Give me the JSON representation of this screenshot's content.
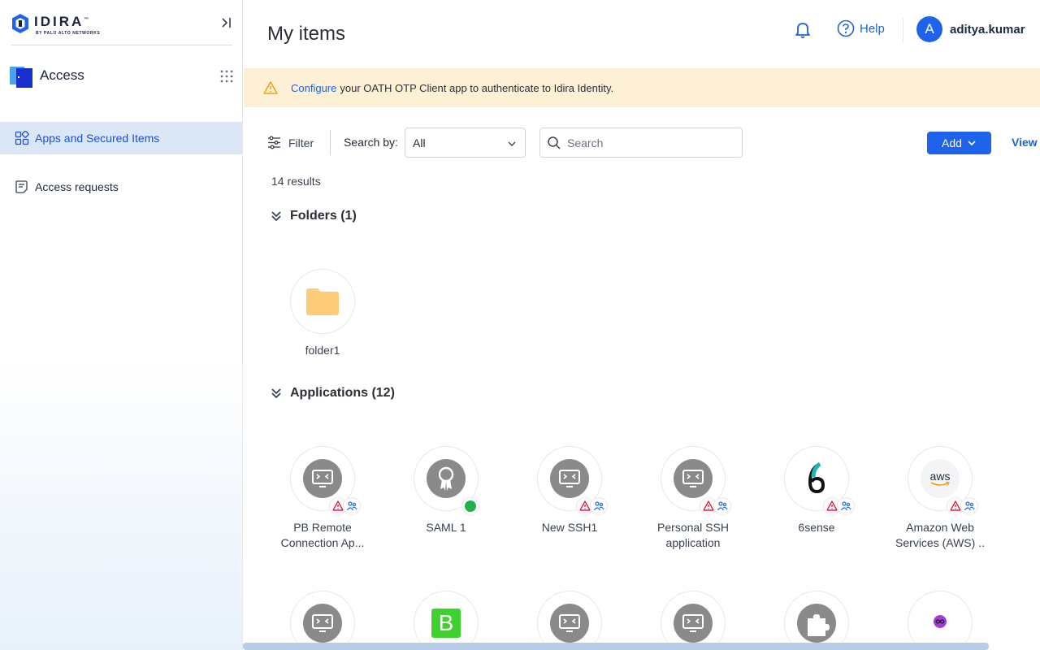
{
  "brand": {
    "name": "IDIRA",
    "trademark": "™",
    "subtitle": "BY PALO ALTO NETWORKS",
    "accent": "#1e63e9"
  },
  "sidebar": {
    "app_name": "Access",
    "items": [
      {
        "label": "Apps and Secured Items",
        "icon": "apps-grid-icon",
        "active": true
      },
      {
        "label": "Access requests",
        "icon": "access-request-icon",
        "active": false
      }
    ]
  },
  "header": {
    "title": "My items",
    "help_label": "Help",
    "user_initial": "A",
    "username": "aditya.kumar"
  },
  "banner": {
    "link_text": "Configure",
    "message": "your OATH OTP Client app to authenticate to Idira Identity.",
    "bg": "#fdf0d5"
  },
  "toolbar": {
    "filter_label": "Filter",
    "search_by_label": "Search by:",
    "search_by_value": "All",
    "search_placeholder": "Search",
    "add_label": "Add",
    "view_label": "View"
  },
  "results_text": "14 results",
  "folders": {
    "heading": "Folders (1)",
    "items": [
      {
        "label": "folder1",
        "icon": "folder-icon"
      }
    ]
  },
  "applications": {
    "heading": "Applications (12)",
    "items": [
      {
        "label_line1": "PB Remote",
        "label_line2": "Connection Ap...",
        "icon": "remote-desktop-icon",
        "status": "warning"
      },
      {
        "label_line1": "SAML 1",
        "label_line2": "",
        "icon": "certificate-icon",
        "status": "ok"
      },
      {
        "label_line1": "New SSH1",
        "label_line2": "",
        "icon": "remote-desktop-icon",
        "status": "warning"
      },
      {
        "label_line1": "Personal SSH",
        "label_line2": "application",
        "icon": "remote-desktop-icon",
        "status": "warning"
      },
      {
        "label_line1": "6sense",
        "label_line2": "",
        "icon": "sixsense-logo-icon",
        "status": "warning"
      },
      {
        "label_line1": "Amazon Web",
        "label_line2": "Services (AWS) ..",
        "icon": "aws-logo-icon",
        "icon_text": "aws",
        "status": "warning"
      },
      {
        "label_line1": "",
        "label_line2": "",
        "icon": "remote-desktop-icon",
        "status": "none"
      },
      {
        "label_line1": "",
        "label_line2": "",
        "icon": "b-logo-icon",
        "icon_text": "B",
        "status": "none"
      },
      {
        "label_line1": "",
        "label_line2": "",
        "icon": "remote-desktop-icon",
        "status": "none"
      },
      {
        "label_line1": "",
        "label_line2": "",
        "icon": "remote-desktop-icon",
        "status": "none"
      },
      {
        "label_line1": "",
        "label_line2": "",
        "icon": "puzzle-piece-icon",
        "status": "none"
      },
      {
        "label_line1": "",
        "label_line2": "",
        "icon": "infinity-logo-icon",
        "status": "none"
      }
    ]
  }
}
